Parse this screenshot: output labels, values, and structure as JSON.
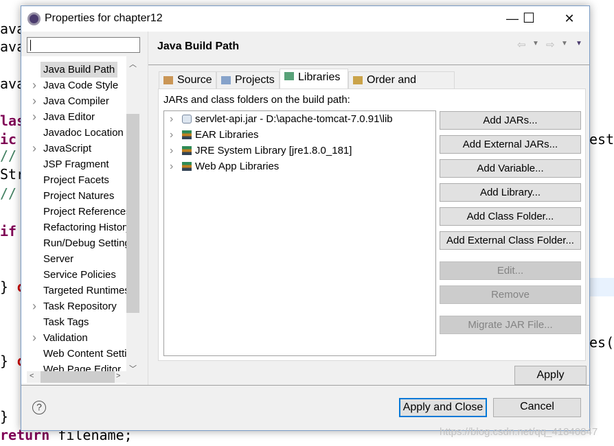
{
  "background_code": {
    "l1": "ava",
    "l2": "ava",
    "l3": "ava",
    "l4": "las",
    "l5": "ic",
    "l6": "//",
    "l7": "Str",
    "l8": "//",
    "l9": "if",
    "l10": "} ",
    "l10b": "c",
    "l11": "} ",
    "l11b": "c",
    "l12": "}",
    "l13": "return filename;",
    "r1": "est",
    "r2": "es("
  },
  "window": {
    "title": "Properties for chapter12",
    "minimize": "—",
    "maximize": "☐",
    "close": "✕"
  },
  "sidebar": {
    "filter_value": "",
    "items": [
      {
        "label": "Java Build Path",
        "expandable": false,
        "selected": true
      },
      {
        "label": "Java Code Style",
        "expandable": true
      },
      {
        "label": "Java Compiler",
        "expandable": true
      },
      {
        "label": "Java Editor",
        "expandable": true
      },
      {
        "label": "Javadoc Location",
        "expandable": false
      },
      {
        "label": "JavaScript",
        "expandable": true
      },
      {
        "label": "JSP Fragment",
        "expandable": false
      },
      {
        "label": "Project Facets",
        "expandable": false
      },
      {
        "label": "Project Natures",
        "expandable": false
      },
      {
        "label": "Project References",
        "expandable": false
      },
      {
        "label": "Refactoring History",
        "expandable": false
      },
      {
        "label": "Run/Debug Settings",
        "expandable": false
      },
      {
        "label": "Server",
        "expandable": false
      },
      {
        "label": "Service Policies",
        "expandable": false
      },
      {
        "label": "Targeted Runtimes",
        "expandable": false
      },
      {
        "label": "Task Repository",
        "expandable": true
      },
      {
        "label": "Task Tags",
        "expandable": false
      },
      {
        "label": "Validation",
        "expandable": true
      },
      {
        "label": "Web Content Settings",
        "expandable": false
      },
      {
        "label": "Web Page Editor",
        "expandable": false
      }
    ]
  },
  "main": {
    "title": "Java Build Path",
    "tabs": [
      {
        "label": "Source",
        "icon": "source-folder-icon"
      },
      {
        "label": "Projects",
        "icon": "projects-folder-icon"
      },
      {
        "label": "Libraries",
        "icon": "library-icon",
        "active": true
      },
      {
        "label": "Order and Export",
        "icon": "order-export-icon"
      }
    ],
    "list_label": "JARs and class folders on the build path:",
    "entries": [
      {
        "label": "servlet-api.jar - D:\\apache-tomcat-7.0.91\\lib",
        "icon": "jar-icon"
      },
      {
        "label": "EAR Libraries",
        "icon": "library-icon"
      },
      {
        "label": "JRE System Library [jre1.8.0_181]",
        "icon": "library-icon"
      },
      {
        "label": "Web App Libraries",
        "icon": "library-icon"
      }
    ],
    "buttons": [
      {
        "label": "Add JARs...",
        "enabled": true
      },
      {
        "label": "Add External JARs...",
        "enabled": true
      },
      {
        "label": "Add Variable...",
        "enabled": true
      },
      {
        "label": "Add Library...",
        "enabled": true
      },
      {
        "label": "Add Class Folder...",
        "enabled": true
      },
      {
        "label": "Add External Class Folder...",
        "enabled": true
      },
      {
        "label": "Edit...",
        "enabled": false
      },
      {
        "label": "Remove",
        "enabled": false
      },
      {
        "label": "Migrate JAR File...",
        "enabled": false
      }
    ],
    "apply": "Apply"
  },
  "footer": {
    "help": "?",
    "apply_close": "Apply and Close",
    "cancel": "Cancel"
  },
  "watermark": "https://blog.csdn.net/qq_41840847",
  "colors": {
    "default_button_border": "#0078d7",
    "keyword": "#7f0055",
    "comment": "#3f7f5f"
  }
}
